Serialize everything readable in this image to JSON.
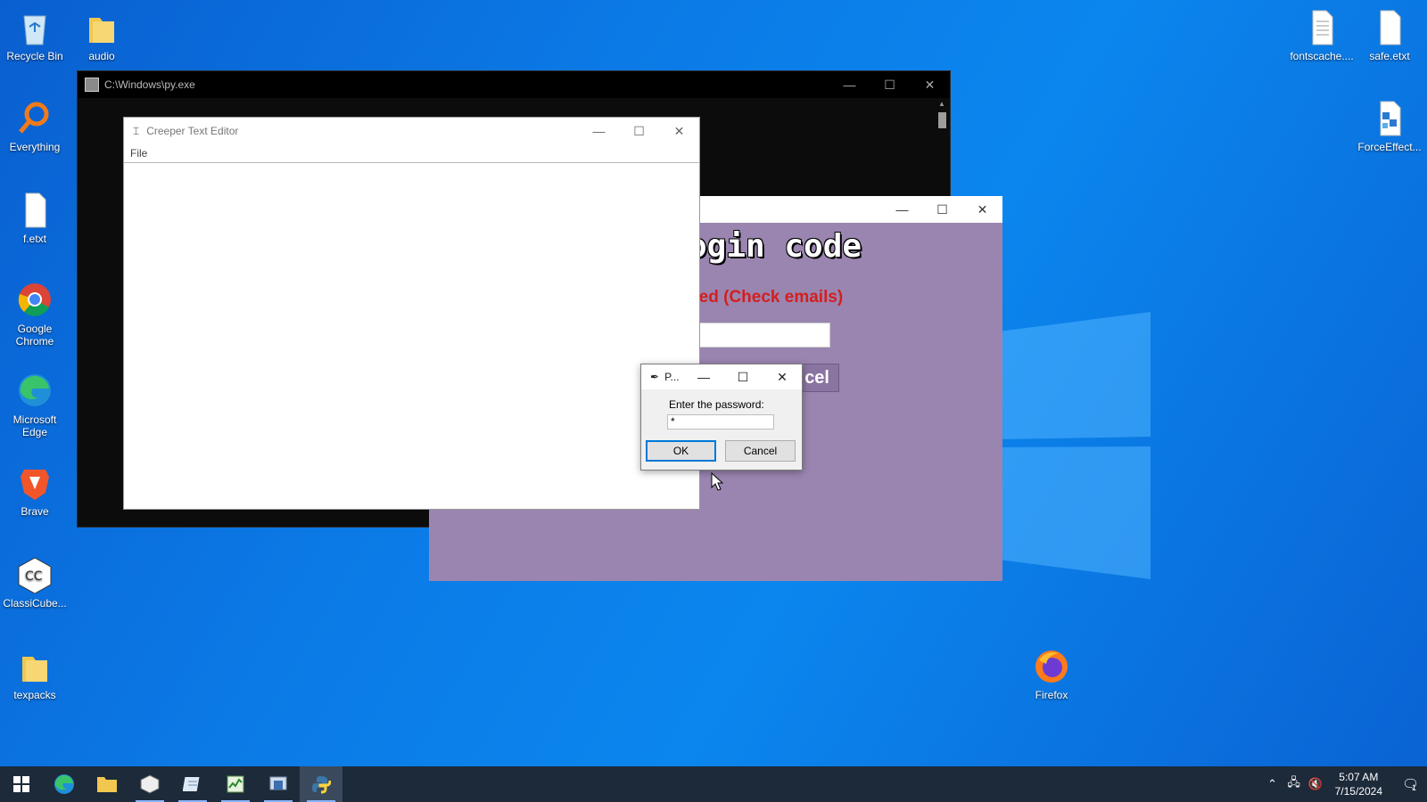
{
  "desktop": {
    "icons_left": [
      {
        "label": "Recycle Bin",
        "icon": "recycle-bin-icon"
      },
      {
        "label": "audio",
        "icon": "folder-icon"
      },
      {
        "label": "Everything",
        "icon": "everything-search-icon"
      },
      {
        "label": "f.etxt",
        "icon": "file-icon"
      },
      {
        "label": "Google Chrome",
        "icon": "chrome-icon"
      },
      {
        "label": "Microsoft Edge",
        "icon": "edge-icon"
      },
      {
        "label": "Brave",
        "icon": "brave-icon"
      },
      {
        "label": "ClassiCube...",
        "icon": "classicube-icon"
      },
      {
        "label": "texpacks",
        "icon": "folder-icon"
      }
    ],
    "icons_right": [
      {
        "label": "fontscache....",
        "icon": "document-icon"
      },
      {
        "label": "safe.etxt",
        "icon": "file-icon"
      },
      {
        "label": "ForceEffect...",
        "icon": "forceeffect-icon"
      },
      {
        "label": "Firefox",
        "icon": "firefox-icon"
      }
    ]
  },
  "console": {
    "title": "C:\\Windows\\py.exe"
  },
  "login_window": {
    "heading": "ogin code",
    "note": "ired (Check emails)",
    "button_label": "cel"
  },
  "editor": {
    "title": "Creeper Text Editor",
    "menu_file": "File"
  },
  "dialog": {
    "title": "P...",
    "prompt": "Enter the password:",
    "value": "*",
    "ok_label": "OK",
    "cancel_label": "Cancel"
  },
  "taskbar": {
    "time": "5:07 AM",
    "date": "7/15/2024",
    "notification_count": "1"
  }
}
